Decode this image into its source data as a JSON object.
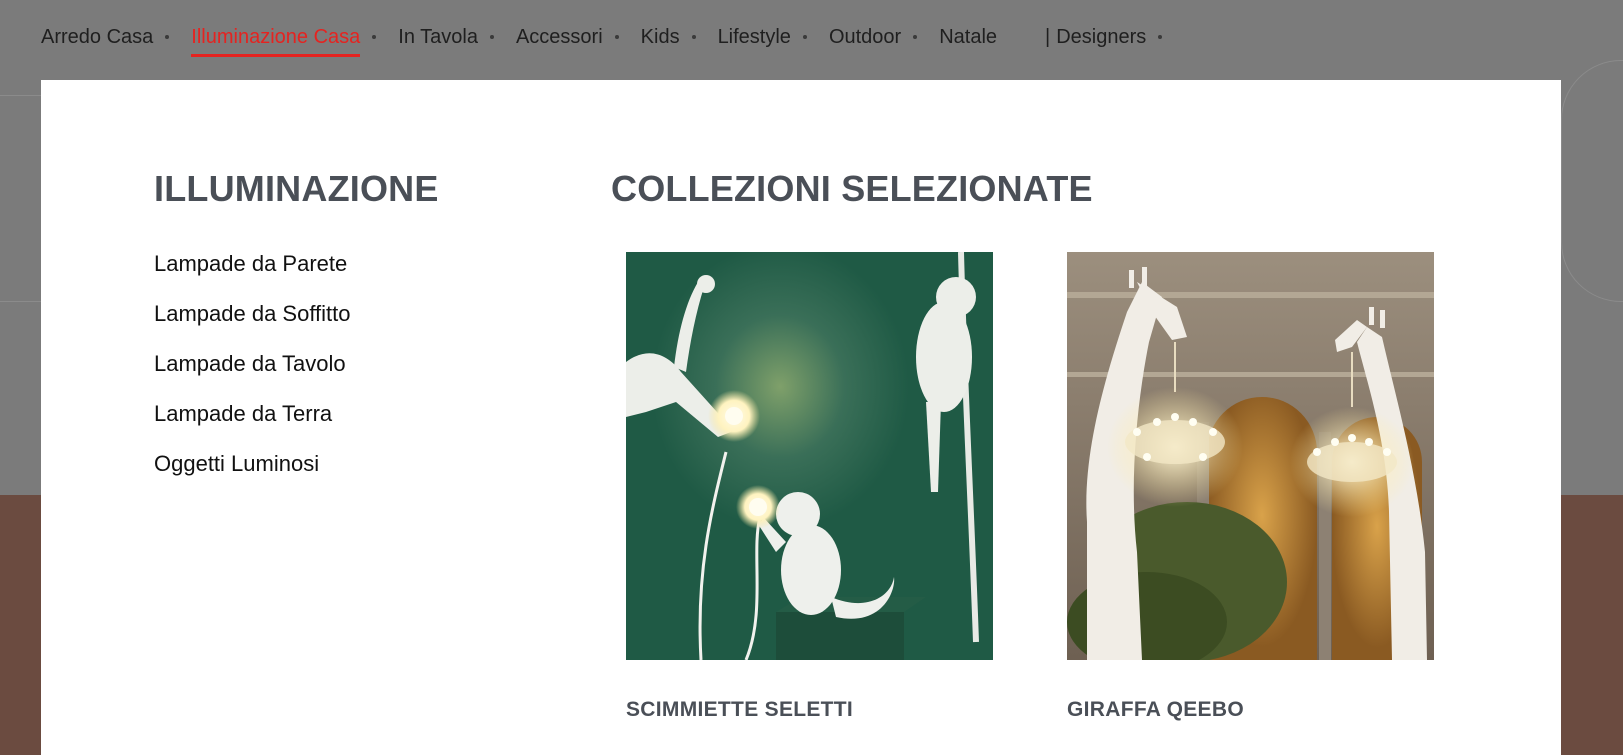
{
  "nav": {
    "items": [
      {
        "label": "Arredo Casa",
        "dot": true,
        "active": false
      },
      {
        "label": "Illuminazione Casa",
        "dot": true,
        "active": true
      },
      {
        "label": "In Tavola",
        "dot": true,
        "active": false
      },
      {
        "label": "Accessori",
        "dot": true,
        "active": false
      },
      {
        "label": "Kids",
        "dot": true,
        "active": false
      },
      {
        "label": "Lifestyle",
        "dot": true,
        "active": false
      },
      {
        "label": "Outdoor",
        "dot": true,
        "active": false
      },
      {
        "label": "Natale",
        "dot": false,
        "active": false
      }
    ],
    "separator": "|",
    "designers_label": "Designers"
  },
  "menu": {
    "left_title": "ILLUMINAZIONE",
    "links": [
      "Lampade da Parete",
      "Lampade da Soffitto",
      "Lampade da Tavolo",
      "Lampade da Terra",
      "Oggetti Luminosi"
    ],
    "right_title": "COLLEZIONI SELEZIONATE",
    "collections": [
      {
        "caption": "SCIMMIETTE SELETTI",
        "image": "white-monkey-lamps-photo"
      },
      {
        "caption": "GIRAFFA QEEBO",
        "image": "giraffe-chandelier-photo"
      }
    ]
  },
  "colors": {
    "accent": "#e52320",
    "heading": "#4a4f57",
    "overlay": "#7b7b7b"
  }
}
